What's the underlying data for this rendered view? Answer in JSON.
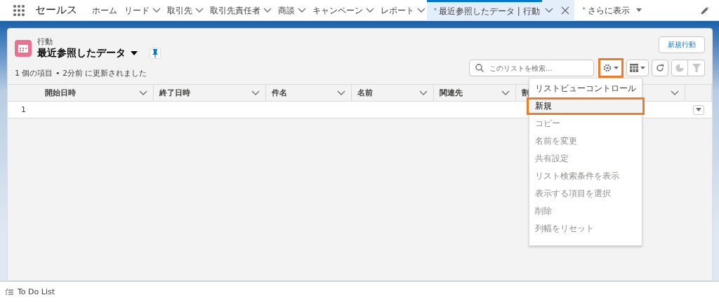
{
  "app_name": "セールス",
  "nav_tabs": [
    {
      "label": "ホーム",
      "has_menu": false,
      "selected": false
    },
    {
      "label": "リード",
      "has_menu": true,
      "selected": false
    },
    {
      "label": "取引先",
      "has_menu": true,
      "selected": false
    },
    {
      "label": "取引先責任者",
      "has_menu": true,
      "selected": false
    },
    {
      "label": "商談",
      "has_menu": true,
      "selected": false
    },
    {
      "label": "キャンペーン",
      "has_menu": true,
      "selected": false
    },
    {
      "label": "レポート",
      "has_menu": true,
      "selected": false
    },
    {
      "label": "最近参照したデータ | 行動",
      "prefix": "*",
      "has_menu": true,
      "closable": true,
      "selected": true
    }
  ],
  "more_tab": {
    "prefix": "*",
    "label": "さらに表示"
  },
  "list_view": {
    "object": "行動",
    "title": "最近参照したデータ",
    "pinned": true,
    "new_button": "新規行動",
    "status": "1 個の項目 • 2分前 に更新されました",
    "search": {
      "placeholder": "このリストを検索..."
    },
    "settings_button": {
      "highlighted": true
    }
  },
  "table": {
    "columns": [
      {
        "label": "開始日時"
      },
      {
        "label": "終了日時"
      },
      {
        "label": "件名"
      },
      {
        "label": "名前"
      },
      {
        "label": "関連先"
      },
      {
        "label": "割"
      },
      {}
    ],
    "rows": [
      {
        "number": "1"
      }
    ]
  },
  "menu": {
    "items": [
      {
        "kind": "header",
        "label": "リストビューコントロール"
      },
      {
        "kind": "item",
        "label": "新規",
        "disabled": false,
        "highlighted": true
      },
      {
        "kind": "item",
        "label": "コピー",
        "disabled": true,
        "highlighted": false
      },
      {
        "kind": "item",
        "label": "名前を変更",
        "disabled": true,
        "highlighted": false
      },
      {
        "kind": "item",
        "label": "共有設定",
        "disabled": true,
        "highlighted": false
      },
      {
        "kind": "item",
        "label": "リスト検索条件を表示",
        "disabled": true,
        "highlighted": false
      },
      {
        "kind": "item",
        "label": "表示する項目を選択",
        "disabled": true,
        "highlighted": false
      },
      {
        "kind": "item",
        "label": "削除",
        "disabled": true,
        "highlighted": false
      },
      {
        "kind": "item",
        "label": "列幅をリセット",
        "disabled": true,
        "highlighted": false
      }
    ]
  },
  "utility_bar": {
    "label": "To Do List"
  }
}
